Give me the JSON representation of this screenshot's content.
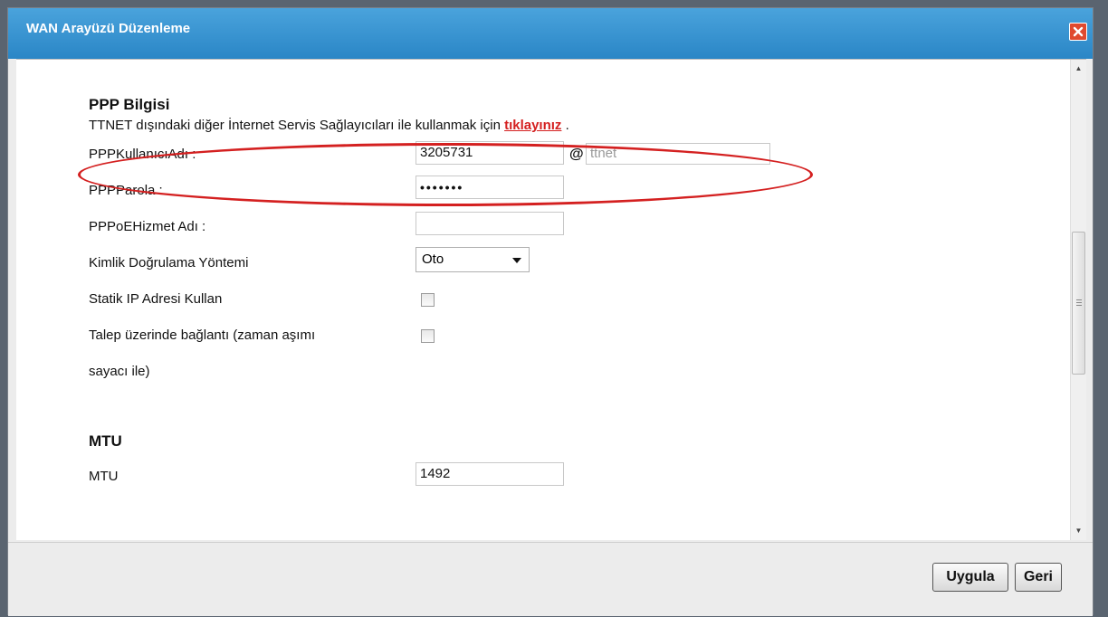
{
  "dialog": {
    "title": "WAN Arayüzü Düzenleme"
  },
  "ppp": {
    "heading": "PPP Bilgisi",
    "note_text": "TTNET dışındaki  diğer İnternet Servis Sağlayıcıları ile kullanmak için ",
    "note_link": "tıklayınız",
    "note_end": " .",
    "username_label": "PPPKullanıcıAdı :",
    "username_value": "3205731",
    "at_sign": "@",
    "domain_value": "ttnet",
    "password_label": "PPPParola :",
    "password_value": "•••••••",
    "service_label": "PPPoEHizmet Adı :",
    "service_value": "",
    "auth_label": "Kimlik Doğrulama Yöntemi",
    "auth_value": "Oto",
    "static_ip_label": "Statik IP Adresi Kullan",
    "static_ip_checked": false,
    "on_demand_label_line1": "Talep üzerinde bağlantı (zaman aşımı",
    "on_demand_label_line2": "sayacı ile)",
    "on_demand_checked": false
  },
  "mtu": {
    "heading": "MTU",
    "label": "MTU",
    "value": "1492"
  },
  "footer": {
    "apply_label": "Uygula",
    "back_label": "Geri"
  },
  "colors": {
    "titlebar": "#2a86c6",
    "highlight_oval": "#d42020",
    "link": "#d42020"
  }
}
